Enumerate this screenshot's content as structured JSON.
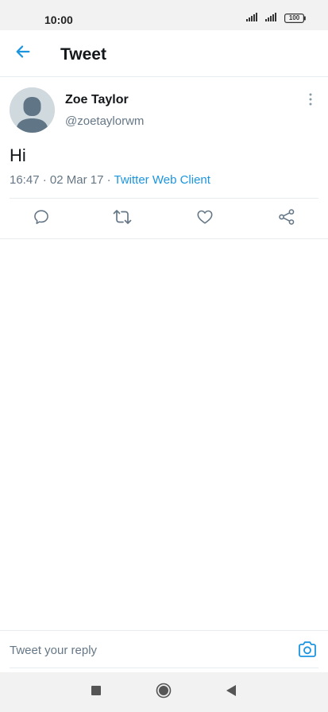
{
  "status_bar": {
    "time": "10:00",
    "battery": "100"
  },
  "header": {
    "title": "Tweet",
    "back_icon": "arrow-left-icon"
  },
  "tweet": {
    "author_name": "Zoe Taylor",
    "author_handle": "@zoetaylorwm",
    "text": "Hi",
    "time": "16:47",
    "date": "02 Mar 17",
    "separator": " · ",
    "source": "Twitter Web Client",
    "more_icon": "more-vertical-icon"
  },
  "actions": [
    {
      "name": "reply",
      "icon": "comment-icon"
    },
    {
      "name": "retweet",
      "icon": "retweet-icon"
    },
    {
      "name": "like",
      "icon": "heart-icon"
    },
    {
      "name": "share",
      "icon": "share-icon"
    }
  ],
  "reply_bar": {
    "placeholder": "Tweet your reply",
    "value": "",
    "camera_icon": "camera-icon"
  },
  "nav_bar": {
    "buttons": [
      "recents-square-icon",
      "home-circle-icon",
      "back-triangle-icon"
    ]
  },
  "colors": {
    "accent": "#1b95e0",
    "text_primary": "#14171a",
    "text_secondary": "#657786",
    "divider": "#e6ecf0",
    "system_bar": "#f2f2f2"
  }
}
